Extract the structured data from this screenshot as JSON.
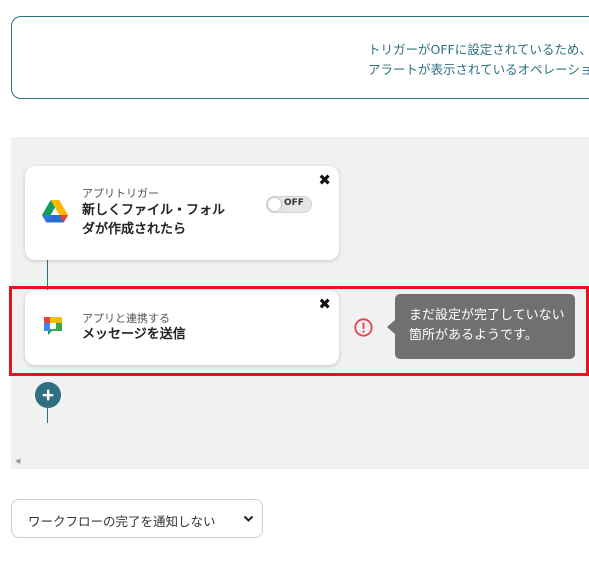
{
  "notice": {
    "line1": "トリガーがOFFに設定されているため、",
    "line2": "アラートが表示されているオペレーショ"
  },
  "flow": {
    "trigger": {
      "type_label": "アプリトリガー",
      "title": "新しくファイル・フォルダが作成されたら",
      "app_icon": "google-drive-icon",
      "toggle_label": "OFF",
      "close_label": "✖"
    },
    "operation": {
      "type_label": "アプリと連携する",
      "title": "メッセージを送信",
      "app_icon": "google-chat-icon",
      "close_label": "✖"
    },
    "warning_tooltip": {
      "line1": "まだ設定が完了していない",
      "line2": "箇所があるようです。"
    },
    "add_icon": "plus-icon",
    "scroll_arrow": "◀"
  },
  "notify_select": {
    "value": "ワークフローの完了を通知しない",
    "icon": "chevron-down-icon"
  },
  "colors": {
    "accent": "#2e6f80",
    "warning": "#e5414e",
    "highlight": "#e5141e",
    "tooltip_bg": "#707070",
    "canvas_bg": "#f1f1f1"
  }
}
